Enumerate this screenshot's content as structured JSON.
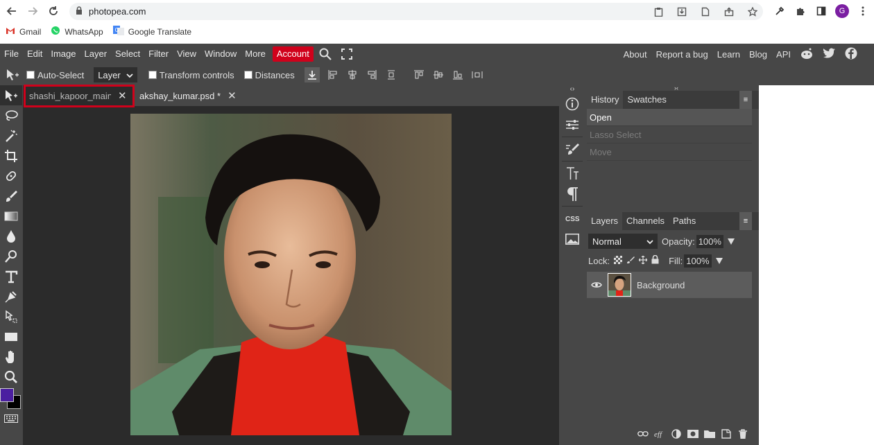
{
  "browser": {
    "url": "photopea.com",
    "avatar_letter": "G",
    "bookmarks": [
      {
        "label": "Gmail",
        "icon": "gmail-icon"
      },
      {
        "label": "WhatsApp",
        "icon": "whatsapp-icon"
      },
      {
        "label": "Google Translate",
        "icon": "google-translate-icon"
      }
    ]
  },
  "menu": {
    "items": [
      "File",
      "Edit",
      "Image",
      "Layer",
      "Select",
      "Filter",
      "View",
      "Window",
      "More"
    ],
    "account": "Account",
    "right_links": [
      "About",
      "Report a bug",
      "Learn",
      "Blog",
      "API"
    ]
  },
  "options": {
    "auto_select": "Auto-Select",
    "layer_select": "Layer",
    "transform_controls": "Transform controls",
    "distances": "Distances"
  },
  "tabs": [
    {
      "label": "shashi_kapoor_main.",
      "active": true
    },
    {
      "label": "akshay_kumar.psd *",
      "active": false
    }
  ],
  "history_panel": {
    "tabs": [
      "History",
      "Swatches"
    ],
    "items": [
      {
        "label": "Open",
        "state": "current"
      },
      {
        "label": "Lasso Select",
        "state": "dim"
      },
      {
        "label": "Move",
        "state": "dim"
      }
    ]
  },
  "layers_panel": {
    "tabs": [
      "Layers",
      "Channels",
      "Paths"
    ],
    "blend_mode": "Normal",
    "opacity_label": "Opacity:",
    "opacity_value": "100%",
    "lock_label": "Lock:",
    "fill_label": "Fill:",
    "fill_value": "100%",
    "layers": [
      {
        "name": "Background",
        "visible": true
      }
    ]
  },
  "colors": {
    "accent_red": "#d0011b",
    "foreground": "#4b1fa0",
    "background": "#000000"
  }
}
